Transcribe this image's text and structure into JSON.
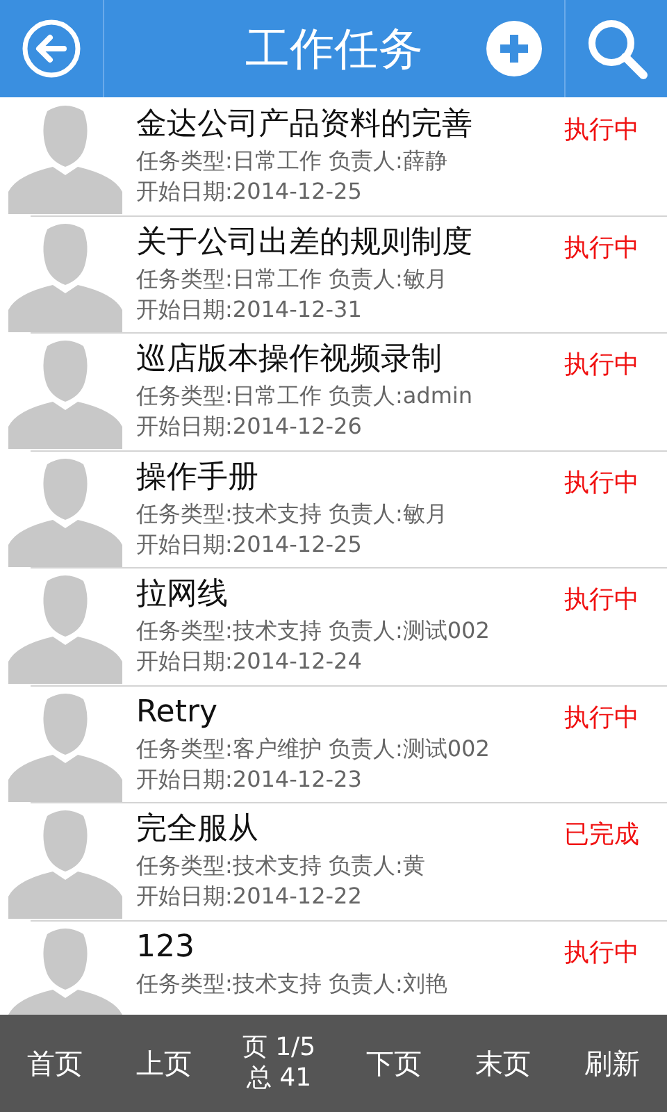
{
  "header": {
    "title": "工作任务"
  },
  "tasks": [
    {
      "title": "金达公司产品资料的完善",
      "status": "执行中",
      "meta": "任务类型:日常工作 负责人:薛静",
      "date": "开始日期:2014-12-25"
    },
    {
      "title": "关于公司出差的规则制度",
      "status": "执行中",
      "meta": "任务类型:日常工作 负责人:敏月",
      "date": "开始日期:2014-12-31"
    },
    {
      "title": "巡店版本操作视频录制",
      "status": "执行中",
      "meta": "任务类型:日常工作 负责人:admin",
      "date": "开始日期:2014-12-26"
    },
    {
      "title": "操作手册",
      "status": "执行中",
      "meta": "任务类型:技术支持 负责人:敏月",
      "date": "开始日期:2014-12-25"
    },
    {
      "title": "拉网线",
      "status": "执行中",
      "meta": "任务类型:技术支持 负责人:测试002",
      "date": "开始日期:2014-12-24"
    },
    {
      "title": "Retry",
      "status": "执行中",
      "meta": "任务类型:客户维护 负责人:测试002",
      "date": "开始日期:2014-12-23"
    },
    {
      "title": "完全服从",
      "status": "已完成",
      "meta": "任务类型:技术支持 负责人:黄",
      "date": "开始日期:2014-12-22"
    },
    {
      "title": "123",
      "status": "执行中",
      "meta": "任务类型:技术支持 负责人:刘艳"
    }
  ],
  "pager": {
    "first": "首页",
    "prev": "上页",
    "page": "页 1/5",
    "total": "总 41",
    "next": "下页",
    "last": "末页",
    "refresh": "刷新"
  }
}
